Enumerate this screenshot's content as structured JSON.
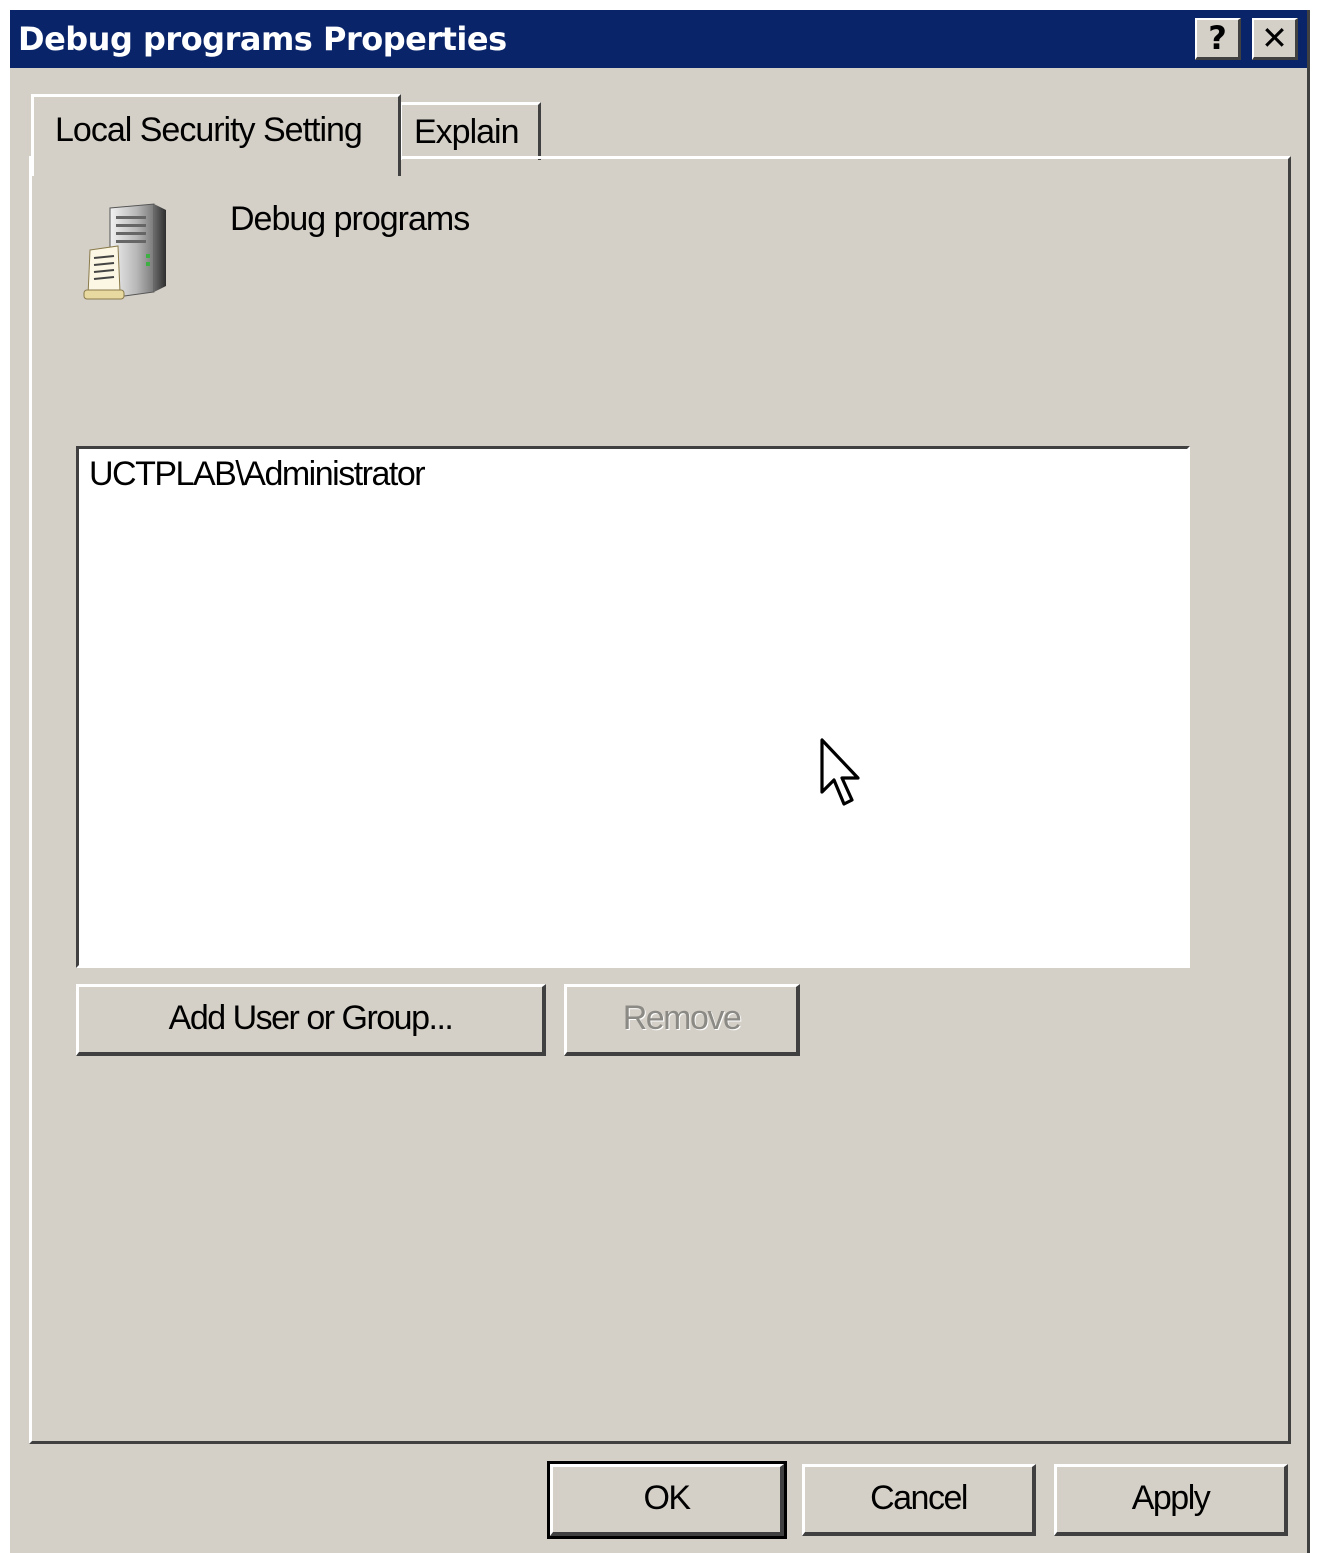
{
  "window": {
    "title": "Debug programs Properties",
    "title_bar_color": "#0a246a",
    "face_color": "#d4d0c8",
    "help_button_label": "?",
    "close_button_label": "✕"
  },
  "tabs": [
    {
      "label": "Local Security Setting",
      "active": true
    },
    {
      "label": "Explain",
      "active": false
    }
  ],
  "policy": {
    "icon": "server-policy-icon",
    "name": "Debug programs"
  },
  "assignments": {
    "items": [
      "UCTPLAB\\Administrator"
    ]
  },
  "buttons": {
    "add": "Add User or Group...",
    "remove": "Remove",
    "remove_disabled": true
  },
  "footer": {
    "ok": "OK",
    "cancel": "Cancel",
    "apply": "Apply"
  },
  "cursor": "arrow-cursor-icon"
}
